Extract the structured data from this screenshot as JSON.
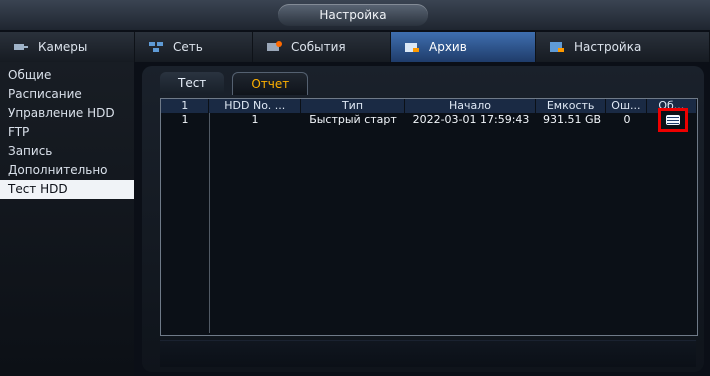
{
  "window": {
    "title": "Настройка"
  },
  "top_tabs": [
    {
      "label": "Камеры",
      "icon": "camera-icon"
    },
    {
      "label": "Сеть",
      "icon": "network-icon"
    },
    {
      "label": "События",
      "icon": "events-icon"
    },
    {
      "label": "Архив",
      "icon": "archive-icon",
      "active": true
    },
    {
      "label": "Настройка",
      "icon": "settings-icon"
    }
  ],
  "sidebar": {
    "items": [
      {
        "label": "Общие"
      },
      {
        "label": "Расписание"
      },
      {
        "label": "Управление HDD"
      },
      {
        "label": "FTP"
      },
      {
        "label": "Запись"
      },
      {
        "label": "Дополнительно"
      },
      {
        "label": "Тест HDD",
        "active": true
      }
    ]
  },
  "subtabs": [
    {
      "label": "Тест"
    },
    {
      "label": "Отчет",
      "active": true
    }
  ],
  "table": {
    "headers": [
      "1",
      "HDD No. ...",
      "Тип",
      "Начало",
      "Емкость",
      "Ош...",
      "Об..."
    ],
    "rows": [
      {
        "num": "1",
        "hdd": "1",
        "type": "Быстрый старт",
        "start": "2022-03-01 17:59:43",
        "capacity": "931.51 GB",
        "errors": "0"
      }
    ]
  },
  "colors": {
    "active_tab": "#3f6fb0",
    "active_subtab_text": "#ffb000",
    "highlight_outline": "#ee0000"
  }
}
